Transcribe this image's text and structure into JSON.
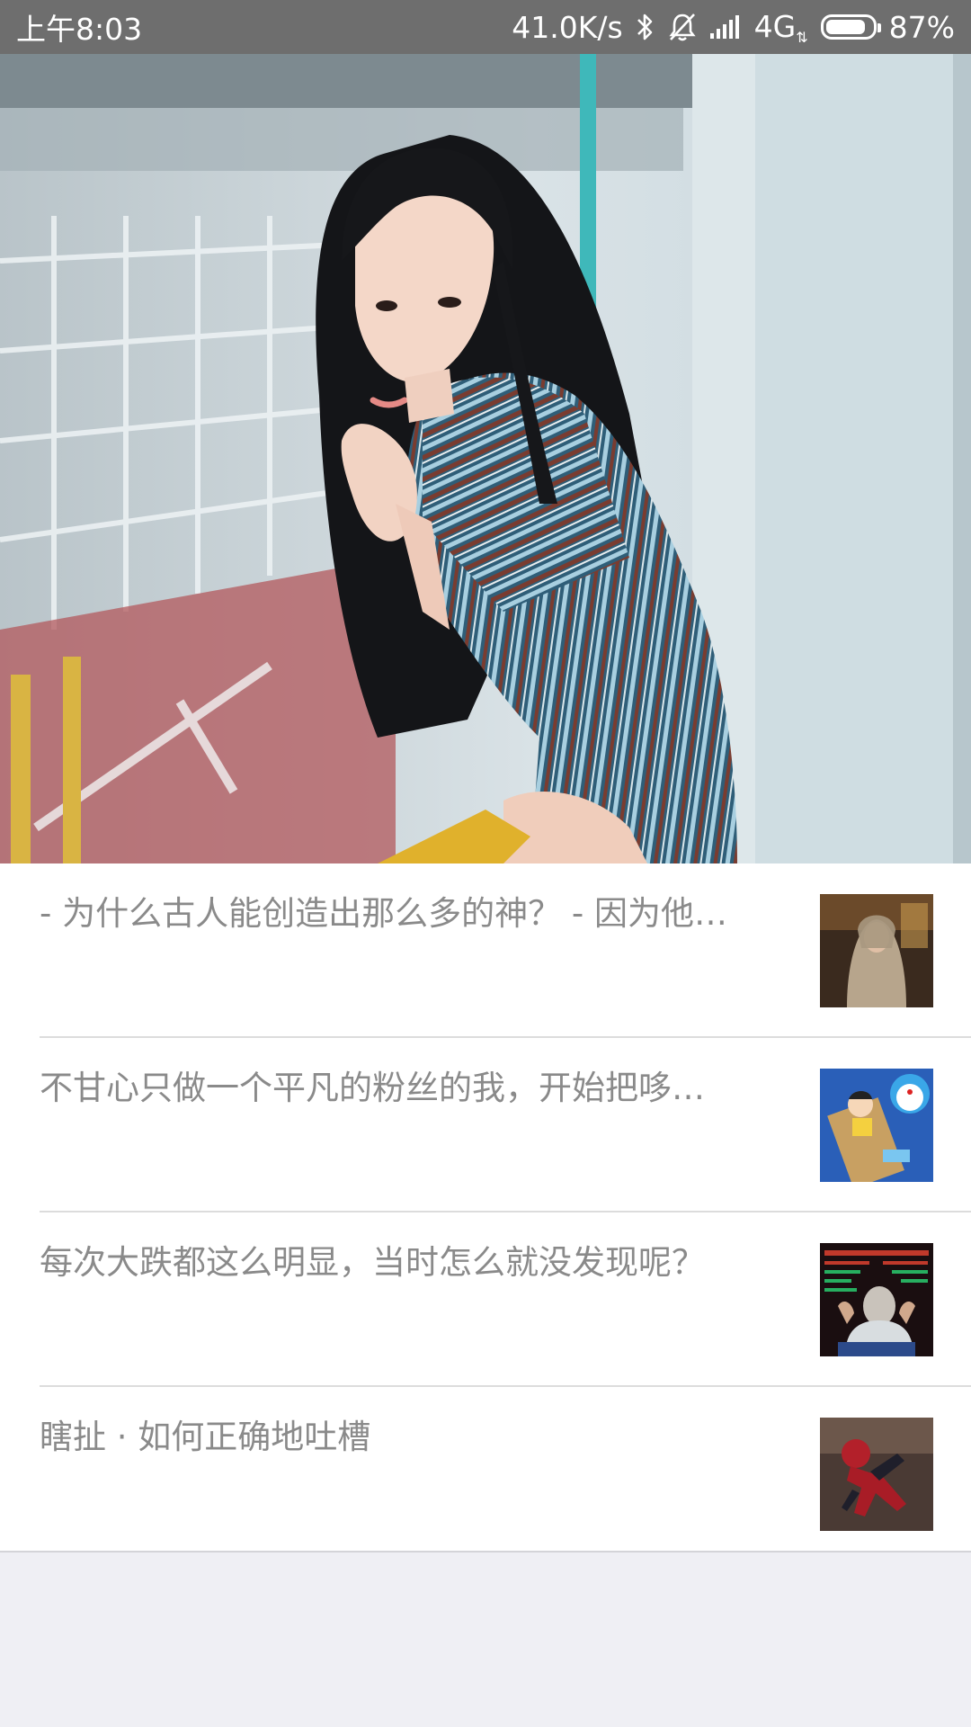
{
  "status_bar": {
    "time": "上午8:03",
    "network_speed": "41.0K/s",
    "network_type": "4G",
    "battery_percent": "87%",
    "battery_level": 0.87,
    "icons": [
      "bluetooth-icon",
      "bell-muted-icon",
      "signal-icon",
      "battery-icon"
    ]
  },
  "hero": {
    "image": "woman-in-striped-shirt-photo"
  },
  "articles": [
    {
      "title": "- 为什么古人能创造出那么多的神？ - 因为他…",
      "thumbnail": "woman-in-shawl-photo"
    },
    {
      "title": "不甘心只做一个平凡的粉丝的我，开始把哆…",
      "thumbnail": "doraemon-cartoon-image"
    },
    {
      "title": "每次大跌都这么明显，当时怎么就没发现呢？",
      "thumbnail": "stock-trader-screens-photo"
    },
    {
      "title": "瞎扯 · 如何正确地吐槽",
      "thumbnail": "spiderman-figure-photo"
    }
  ],
  "colors": {
    "status_bar": "#6e6e6e",
    "list_text": "#8a8a8a",
    "divider": "#dcdcdc",
    "page_bg": "#efeff4"
  }
}
